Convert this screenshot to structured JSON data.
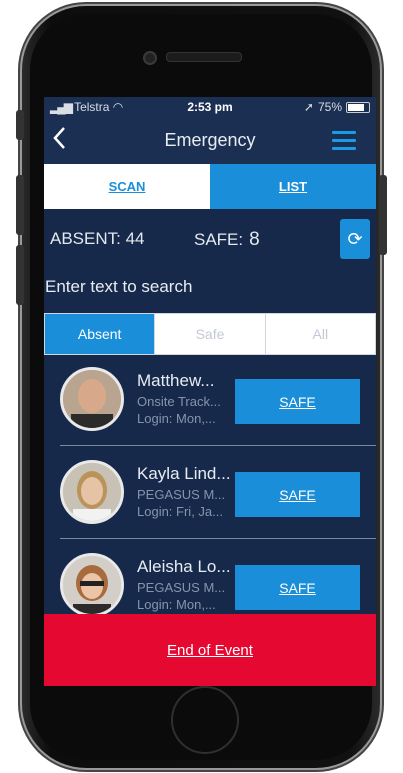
{
  "status": {
    "carrier": "Telstra",
    "time": "2:53 pm",
    "battery": "75%"
  },
  "nav": {
    "title": "Emergency"
  },
  "top_tabs": [
    {
      "label": "SCAN"
    },
    {
      "label": "LIST"
    }
  ],
  "counts": {
    "absent_label": "ABSENT: 44",
    "safe_label": "SAFE:",
    "safe_value": "8"
  },
  "search": {
    "placeholder": "Enter text to search"
  },
  "filters": [
    {
      "label": "Absent"
    },
    {
      "label": "Safe"
    },
    {
      "label": "All"
    }
  ],
  "people": [
    {
      "name": "Matthew...",
      "company": "Onsite Track...",
      "login": "Login: Mon,...",
      "action": "SAFE"
    },
    {
      "name": "Kayla Lind...",
      "company": "PEGASUS M...",
      "login": "Login: Fri, Ja...",
      "action": "SAFE"
    },
    {
      "name": "Aleisha Lo...",
      "company": "PEGASUS M...",
      "login": "Login: Mon,...",
      "action": "SAFE"
    }
  ],
  "footer": {
    "end_label": "End of Event"
  },
  "colors": {
    "accent": "#1a8ed8",
    "background": "#16294a",
    "danger": "#e50932"
  }
}
